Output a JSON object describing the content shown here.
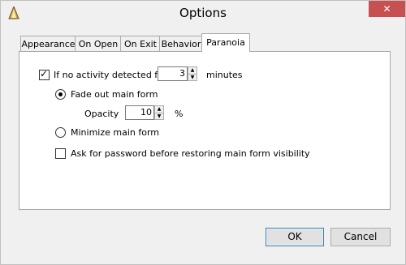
{
  "window": {
    "title": "Options",
    "close_glyph": "✕"
  },
  "tabs": [
    {
      "label": "Appearance"
    },
    {
      "label": "On Open"
    },
    {
      "label": "On Exit"
    },
    {
      "label": "Behavior"
    },
    {
      "label": "Paranoia"
    }
  ],
  "paranoia": {
    "inactivity_checked": true,
    "inactivity_label": "If no activity detected for",
    "inactivity_value": "3",
    "inactivity_unit": "minutes",
    "fade_selected": true,
    "fade_label": "Fade out main form",
    "opacity_label": "Opacity",
    "opacity_value": "10",
    "opacity_unit": "%",
    "minimize_label": "Minimize main form",
    "password_checked": false,
    "password_label": "Ask for password before restoring main form visibility"
  },
  "buttons": {
    "ok": "OK",
    "cancel": "Cancel"
  },
  "glyphs": {
    "check": "✓",
    "spin_up": "▲",
    "spin_down": "▼"
  }
}
